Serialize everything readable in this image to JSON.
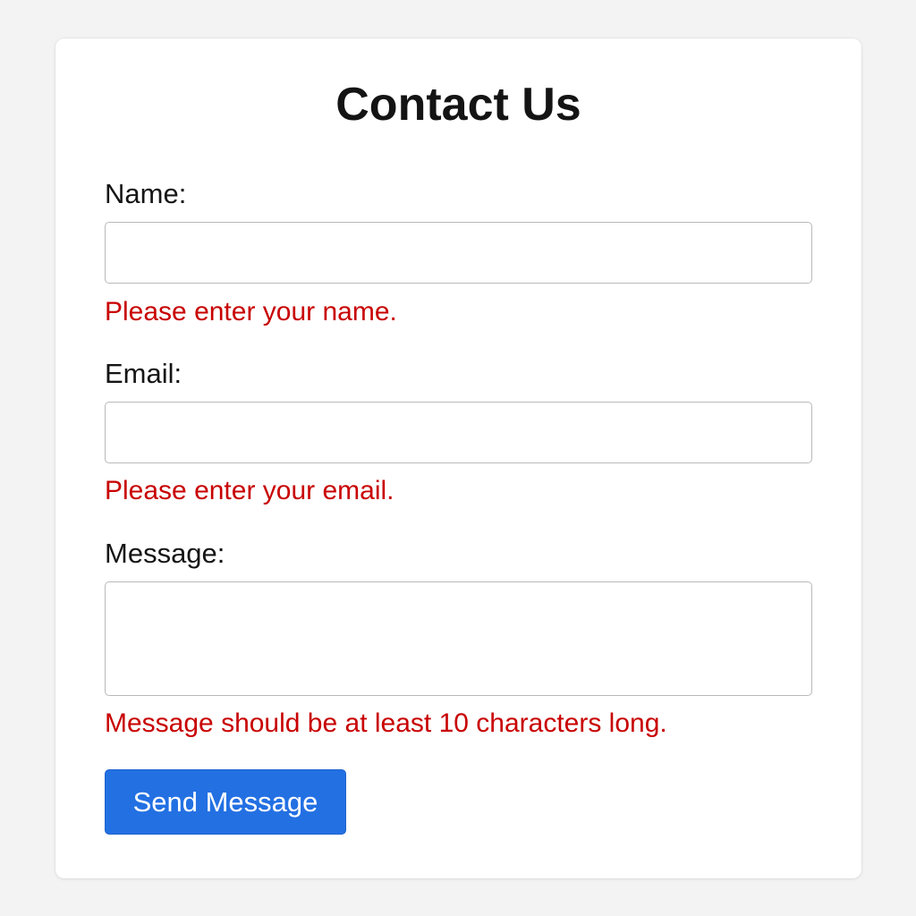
{
  "form": {
    "title": "Contact Us",
    "fields": [
      {
        "label": "Name:",
        "value": "",
        "placeholder": "",
        "error": "Please enter your name."
      },
      {
        "label": "Email:",
        "value": "",
        "placeholder": "",
        "error": "Please enter your email."
      },
      {
        "label": "Message:",
        "value": "",
        "placeholder": "",
        "error": "Message should be at least 10 characters long."
      }
    ],
    "submit_label": "Send Message"
  },
  "colors": {
    "background": "#f3f3f3",
    "card": "#ffffff",
    "error": "#c80000",
    "button": "#2370e3",
    "button_text": "#ffffff"
  }
}
